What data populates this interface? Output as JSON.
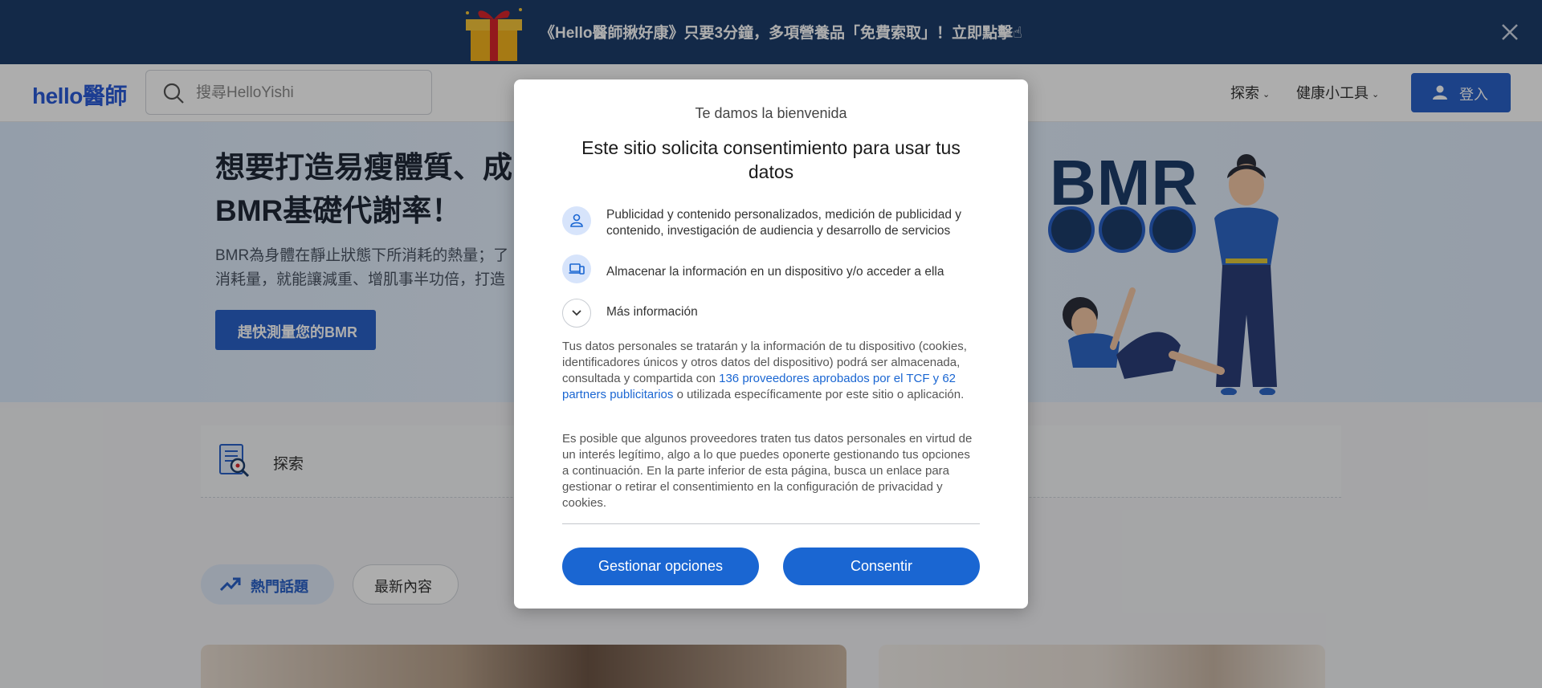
{
  "promo": {
    "text": "《Hello醫師揪好康》只要3分鐘，多項營養品「免費索取」！立即點擊☝"
  },
  "header": {
    "logo": "hello醫師",
    "search_placeholder": "搜尋HelloYishi",
    "nav": [
      "探索",
      "健康小工具"
    ],
    "login_label": "登入"
  },
  "hero": {
    "title": "想要打造易瘦體質、成\nBMR基礎代謝率！",
    "description": "BMR為身體在靜止狀態下所消耗的熱量；了\n消耗量，就能讓減重、增肌事半功倍，打造",
    "cta_label": "趕快測量您的BMR",
    "badge_text": "BMR"
  },
  "explore": {
    "label": "探索"
  },
  "tabs": {
    "hot": "熱門話題",
    "latest": "最新內容"
  },
  "consent": {
    "welcome": "Te damos la bienvenida",
    "title": "Este sitio solicita consentimiento para usar tus datos",
    "purposes": [
      {
        "icon": "person-icon",
        "text": "Publicidad y contenido personalizados, medición de publicidad y contenido, investigación de audiencia y desarrollo de servicios"
      },
      {
        "icon": "devices-icon",
        "text": "Almacenar la información en un dispositivo y/o acceder a ella"
      }
    ],
    "more_info": "Más información",
    "para1_before": "Tus datos personales se tratarán y la información de tu dispositivo (cookies, identificadores únicos y otros datos del dispositivo) podrá ser almacenada, consultada y compartida con ",
    "para1_link": "136 proveedores aprobados por el TCF y 62 partners publicitarios",
    "para1_after": " o utilizada específicamente por este sitio o aplicación.",
    "para2": "Es posible que algunos proveedores traten tus datos personales en virtud de un interés legítimo, algo a lo que puedes oponerte gestionando tus opciones a continuación. En la parte inferior de esta página, busca un enlace para gestionar o retirar el consentimiento en la configuración de privacidad y cookies.",
    "manage_label": "Gestionar opciones",
    "consent_label": "Consentir"
  },
  "colors": {
    "brand_blue": "#2a62c9",
    "banner_navy": "#1c3d6b",
    "consent_blue": "#1a66d2"
  }
}
